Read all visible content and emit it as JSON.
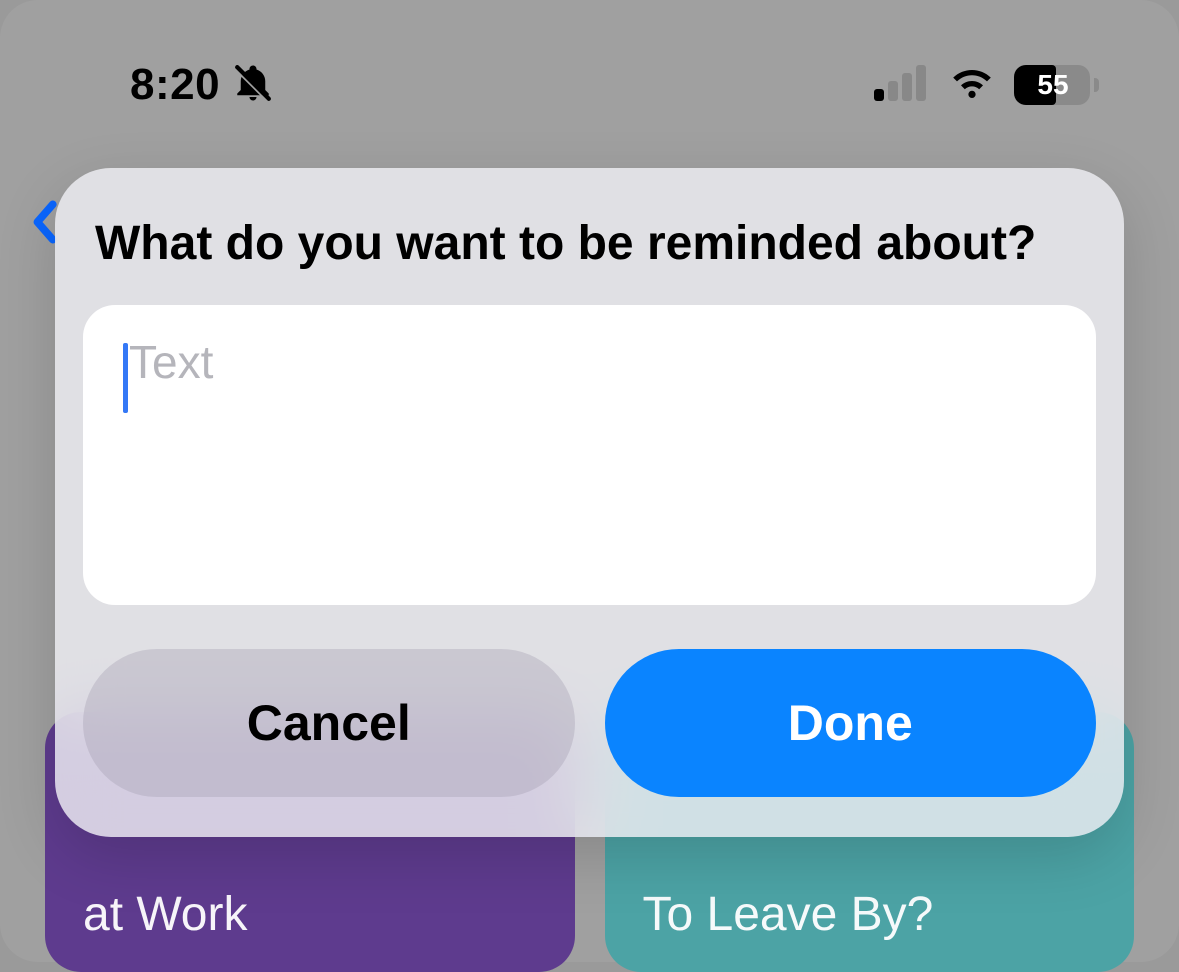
{
  "status_bar": {
    "time": "8:20",
    "battery_percent": "55"
  },
  "background": {
    "card_left_label": "at Work",
    "card_right_label": "To Leave By?"
  },
  "dialog": {
    "title": "What do you want to be reminded about?",
    "input_value": "",
    "input_placeholder": "Text",
    "cancel_label": "Cancel",
    "done_label": "Done"
  },
  "colors": {
    "accent_blue": "#0a84ff",
    "card_purple": "#5e3b8e",
    "card_teal": "#4ca3a5"
  }
}
